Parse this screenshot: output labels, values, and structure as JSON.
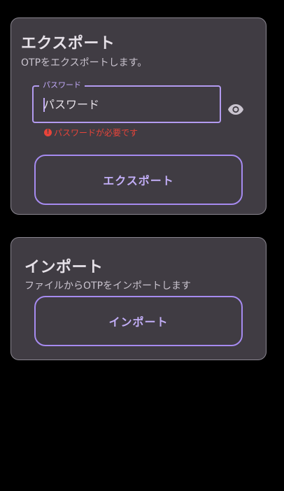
{
  "export_section": {
    "title": "エクスポート",
    "subtitle": "OTPをエクスポートします。",
    "password_field": {
      "label": "パスワード",
      "value": "パスワード"
    },
    "visibility_icon": "eye-icon",
    "error_text": "パスワードが必要です",
    "error_icon": "!",
    "export_button_label": "エクスポート"
  },
  "import_section": {
    "title": "インポート",
    "subtitle": "ファイルからOTPをインポートします",
    "import_button_label": "インポート"
  },
  "colors": {
    "background": "#000000",
    "card": "#403c43",
    "accent": "#b39bf0",
    "error": "#e8443a"
  }
}
